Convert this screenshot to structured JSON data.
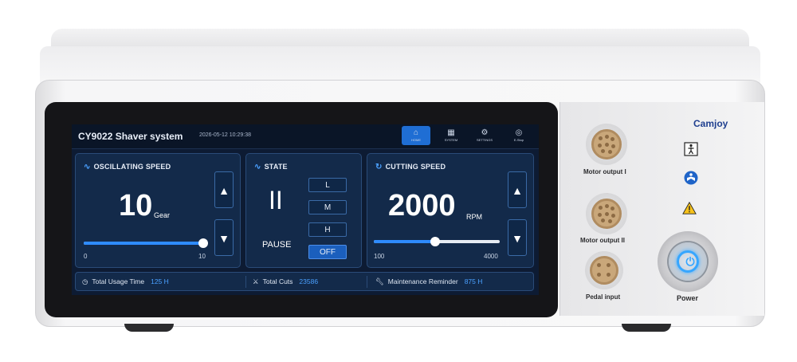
{
  "header": {
    "title": "CY9022 Shaver system",
    "datetime": "2026-05-12 10:29:38",
    "nav": [
      {
        "label": "HOME",
        "icon": "home-icon"
      },
      {
        "label": "SYSTEM",
        "icon": "grid-icon"
      },
      {
        "label": "SETTINGS",
        "icon": "gear-icon"
      },
      {
        "label": "E-Stop",
        "icon": "estop-icon"
      }
    ]
  },
  "oscillating": {
    "title": "OSCILLATING SPEED",
    "value": "10",
    "unit": "Gear",
    "min": "0",
    "max": "10",
    "slider_fraction": 1.0
  },
  "state": {
    "title": "STATE",
    "symbol": "II",
    "label": "PAUSE",
    "modes": [
      "L",
      "M",
      "H",
      "OFF"
    ],
    "active_mode": "OFF"
  },
  "cutting": {
    "title": "CUTTING SPEED",
    "value": "2000",
    "unit": "RPM",
    "min": "100",
    "max": "4000",
    "slider_fraction": 0.487
  },
  "status": {
    "usage_label": "Total Usage Time",
    "usage_value": "125 H",
    "cuts_label": "Total Cuts",
    "cuts_value": "23586",
    "maint_label": "Maintenance Reminder",
    "maint_value": "875 H"
  },
  "device": {
    "brand": "Camjoy",
    "port1": "Motor output I",
    "port2": "Motor output II",
    "port3": "Pedal input",
    "power": "Power"
  },
  "colors": {
    "accent": "#2e8bff",
    "screen_bg": "#0d1b33",
    "panel_bg": "#132a4a",
    "power_led": "#36a6ff"
  }
}
